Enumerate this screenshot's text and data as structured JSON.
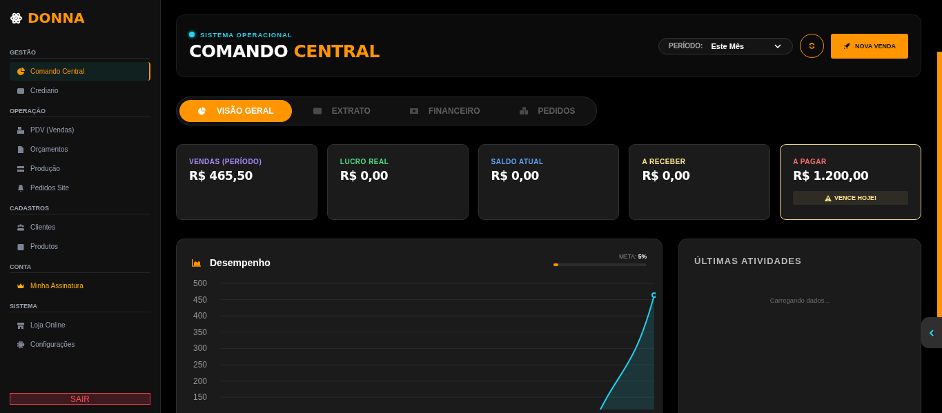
{
  "brand": {
    "name": "DONNA"
  },
  "sidebar": {
    "sections": [
      {
        "title": "GESTÃO",
        "items": [
          {
            "label": "Comando Central",
            "selected": true,
            "highlighted": false
          },
          {
            "label": "Crediario",
            "selected": false,
            "highlighted": false
          }
        ]
      },
      {
        "title": "OPERAÇÃO",
        "items": [
          {
            "label": "PDV (Vendas)",
            "selected": false,
            "highlighted": false
          },
          {
            "label": "Orçamentos",
            "selected": false,
            "highlighted": false
          },
          {
            "label": "Produção",
            "selected": false,
            "highlighted": false
          },
          {
            "label": "Pedidos Site",
            "selected": false,
            "highlighted": false
          }
        ]
      },
      {
        "title": "CADASTROS",
        "items": [
          {
            "label": "Clientes",
            "selected": false,
            "highlighted": false
          },
          {
            "label": "Produtos",
            "selected": false,
            "highlighted": false
          }
        ]
      },
      {
        "title": "CONTA",
        "items": [
          {
            "label": "Minha Assinatura",
            "selected": false,
            "highlighted": true
          }
        ]
      },
      {
        "title": "SISTEMA",
        "items": [
          {
            "label": "Loja Online",
            "selected": false,
            "highlighted": false
          },
          {
            "label": "Configurações",
            "selected": false,
            "highlighted": false
          }
        ]
      }
    ],
    "logout": "SAIR"
  },
  "header": {
    "status": "SISTEMA OPERACIONAL",
    "title": "COMANDO",
    "title_accent": "CENTRAL",
    "period_label": "PERÍODO:",
    "period_value": "Este Mês",
    "new_sale": "NOVA VENDA"
  },
  "tabs": [
    {
      "label": "VISÃO GERAL",
      "selected": true
    },
    {
      "label": "EXTRATO",
      "selected": false
    },
    {
      "label": "FINANCEIRO",
      "selected": false
    },
    {
      "label": "PEDIDOS",
      "selected": false
    }
  ],
  "stats": [
    {
      "label": "VENDAS (PERÍODO)",
      "value": "R$ 465,50",
      "color": "#a78bfa",
      "highlighted": false
    },
    {
      "label": "LUCRO REAL",
      "value": "R$ 0,00",
      "color": "#4ade80",
      "highlighted": false
    },
    {
      "label": "SALDO ATUAL",
      "value": "R$ 0,00",
      "color": "#60a5fa",
      "highlighted": false
    },
    {
      "label": "A RECEBER",
      "value": "R$ 0,00",
      "color": "#fde68a",
      "highlighted": false
    },
    {
      "label": "A PAGAR",
      "value": "R$ 1.200,00",
      "color": "#f87171",
      "highlighted": true,
      "badge": "VENCE HOJE!"
    }
  ],
  "performance": {
    "title": "Desempenho",
    "goal": "META: **5%**",
    "level": 0.05,
    "y_axis_labels": [
      "500",
      "450",
      "400",
      "350",
      "300",
      "250",
      "200",
      "150"
    ]
  },
  "activity": {
    "title": "ÚLTIMAS ATIVIDADES",
    "empty": "Carregando dados..."
  }
}
